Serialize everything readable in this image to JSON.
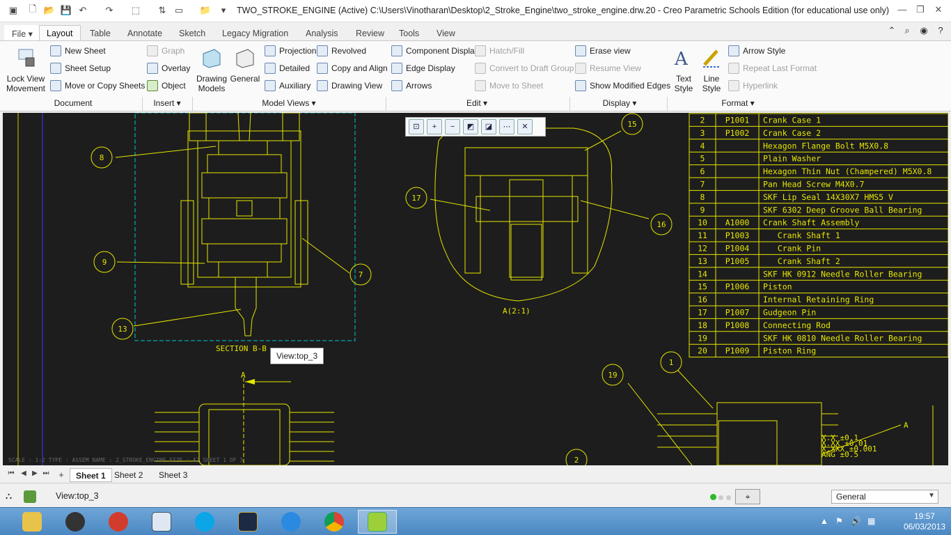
{
  "window": {
    "title": "TWO_STROKE_ENGINE (Active) C:\\Users\\Vinotharan\\Desktop\\2_Stroke_Engine\\two_stroke_engine.drw.20 - Creo Parametric Schools Edition (for educational use only)",
    "minimize": "—",
    "restore": "❐",
    "close": "✕"
  },
  "tabs": [
    "File",
    "Layout",
    "Table",
    "Annotate",
    "Sketch",
    "Legacy Migration",
    "Analysis",
    "Review",
    "Tools",
    "View"
  ],
  "ribbon": {
    "lock_view_movement": "Lock View Movement",
    "new_sheet": "New Sheet",
    "sheet_setup": "Sheet Setup",
    "move_copy_sheets": "Move or Copy Sheets",
    "graph": "Graph",
    "overlay": "Overlay",
    "object": "Object",
    "drawing_models": "Drawing Models",
    "general": "General",
    "projection": "Projection",
    "detailed": "Detailed",
    "auxiliary": "Auxiliary",
    "revolved": "Revolved",
    "copy_align": "Copy and Align",
    "drawing_view": "Drawing View",
    "component_display": "Component Display",
    "edge_display": "Edge Display",
    "arrows": "Arrows",
    "hatch_fill": "Hatch/Fill",
    "convert_draft": "Convert to Draft Group",
    "move_to_sheet": "Move to Sheet",
    "erase_view": "Erase view",
    "resume_view": "Resume View",
    "show_modified_edges": "Show Modified Edges",
    "text_style": "Text Style",
    "line_style": "Line Style",
    "arrow_style": "Arrow Style",
    "repeat_last_format": "Repeat Last Format",
    "hyperlink": "Hyperlink",
    "groups": [
      "Document",
      "Insert ▾",
      "Model Views ▾",
      "Edit ▾",
      "Display ▾",
      "Format ▾"
    ]
  },
  "drawing": {
    "section_label": "SECTION B-B",
    "detail_label": "A(2:1)",
    "arrow_label": "A",
    "balloons": [
      "8",
      "9",
      "13",
      "7",
      "15",
      "17",
      "16",
      "1",
      "19",
      "2"
    ],
    "tolerances": [
      "X.X  ±0.1",
      "X.XX  ±0.01",
      "X.XXX  ±0.001",
      "ANG  ±0.5"
    ],
    "leader_label": "A",
    "info_line": "SCALE : 1:2     TYPE : ASSEM     NAME : 2_STROKE_ENGINE     SIZE : A2     SHEET 1 OF 3"
  },
  "bom": [
    [
      "2",
      "P1001",
      "Crank Case 1"
    ],
    [
      "3",
      "P1002",
      "Crank Case 2"
    ],
    [
      "4",
      "",
      "Hexagon Flange Bolt M5X0.8"
    ],
    [
      "5",
      "",
      "Plain Washer"
    ],
    [
      "6",
      "",
      "Hexagon Thin Nut (Champered) M5X0.8"
    ],
    [
      "7",
      "",
      "Pan Head Screw M4X0.7"
    ],
    [
      "8",
      "",
      "SKF Lip Seal 14X30X7 HMS5 V"
    ],
    [
      "9",
      "",
      "SKF 6302 Deep Groove Ball Bearing"
    ],
    [
      "10",
      "A1000",
      "Crank Shaft Assembly"
    ],
    [
      "11",
      "P1003",
      "   Crank Shaft 1"
    ],
    [
      "12",
      "P1004",
      "   Crank Pin"
    ],
    [
      "13",
      "P1005",
      "   Crank Shaft 2"
    ],
    [
      "14",
      "",
      "SKF HK 0912 Needle Roller Bearing"
    ],
    [
      "15",
      "P1006",
      "Piston"
    ],
    [
      "16",
      "",
      "Internal Retaining Ring"
    ],
    [
      "17",
      "P1007",
      "Gudgeon Pin"
    ],
    [
      "18",
      "P1008",
      "Connecting Rod"
    ],
    [
      "19",
      "",
      "SKF HK 0810 Needle Roller Bearing"
    ],
    [
      "20",
      "P1009",
      "Piston Ring"
    ]
  ],
  "tooltip": "View:top_3",
  "sheets": [
    "Sheet 1",
    "Sheet 2",
    "Sheet 3"
  ],
  "status": {
    "message": "View:top_3",
    "filter": "General"
  },
  "taskbar": {
    "apps": [
      "file-explorer",
      "steam",
      "ccleaner",
      "window-app",
      "skype",
      "league-of-legends",
      "internet-explorer",
      "chrome",
      "creo"
    ],
    "time": "19:57",
    "date": "06/03/2013"
  }
}
